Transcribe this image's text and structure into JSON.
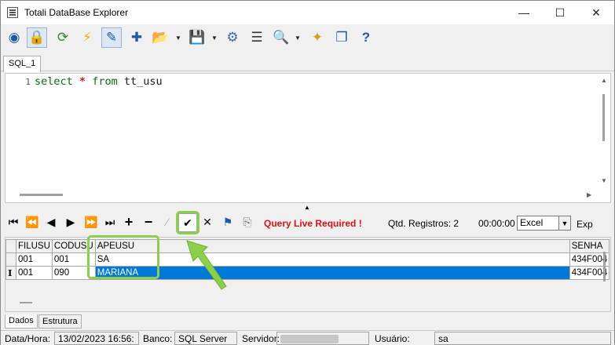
{
  "window": {
    "title": "Totali DataBase Explorer",
    "minimize_glyph": "—",
    "maximize_glyph": "☐",
    "close_glyph": "✕"
  },
  "toolbar": {
    "icons": [
      "connect-icon",
      "lock-icon",
      "refresh-icon",
      "execute-icon",
      "edit-icon",
      "new-tab-icon",
      "open-folder-icon",
      "save-icon",
      "tools-icon",
      "list-icon",
      "find-icon",
      "wizard-icon",
      "windows-icon",
      "help-icon"
    ],
    "glyphs": {
      "connect": "◉",
      "lock": "🔒",
      "refresh": "⟳",
      "execute": "⚡",
      "edit": "✎",
      "new_tab": "✚",
      "open": "📂",
      "save": "💾",
      "tools": "⚙",
      "list": "☰",
      "find": "🔍",
      "wizard": "✦",
      "windows": "❐",
      "help": "?"
    },
    "dropdown_glyph": "▼"
  },
  "query_tabs": [
    {
      "label": "SQL_1"
    }
  ],
  "editor": {
    "line_number": "1",
    "tokens": {
      "select": "select",
      "star": "*",
      "from": "from",
      "table": "tt_usu"
    }
  },
  "splitter_glyph": "▲",
  "navigator": {
    "glyphs": {
      "first": "⏮",
      "prior": "⏪",
      "prev": "◀",
      "next": "▶",
      "next_page": "⏩",
      "last": "⏭",
      "insert": "+",
      "delete": "−",
      "edit": "⁄",
      "post": "✔",
      "cancel": "✕",
      "bookmark": "⚑",
      "goto": "⎘"
    },
    "status": "Query Live Required !",
    "records_label": "Qtd. Registros: 2",
    "elapsed": "00:00:00",
    "export_format": "Excel",
    "export_label": "Exp",
    "status_color": "#e01010"
  },
  "grid": {
    "columns": [
      "FILUSU",
      "CODUSU",
      "APEUSU",
      "SENHA"
    ],
    "rows": [
      {
        "indicator": "",
        "FILUSU": "001",
        "CODUSU": "001",
        "APEUSU": "SA",
        "SENHA": "434F004"
      },
      {
        "indicator": "I",
        "FILUSU": "001",
        "CODUSU": "090",
        "APEUSU": "MARIANA",
        "SENHA": "434F004"
      }
    ],
    "selected_row": 1,
    "selection_color": "#0078d7"
  },
  "result_tabs": [
    {
      "label": "Dados"
    },
    {
      "label": "Estrutura"
    }
  ],
  "statusbar": {
    "date_label": "Data/Hora:",
    "date_value": "13/02/2023 16:56:",
    "db_label": "Banco:",
    "db_value": "SQL Server",
    "server_label": "Servidor:",
    "user_label": "Usuário:",
    "user_value": "sa"
  },
  "annotation_color": "#8bd048"
}
